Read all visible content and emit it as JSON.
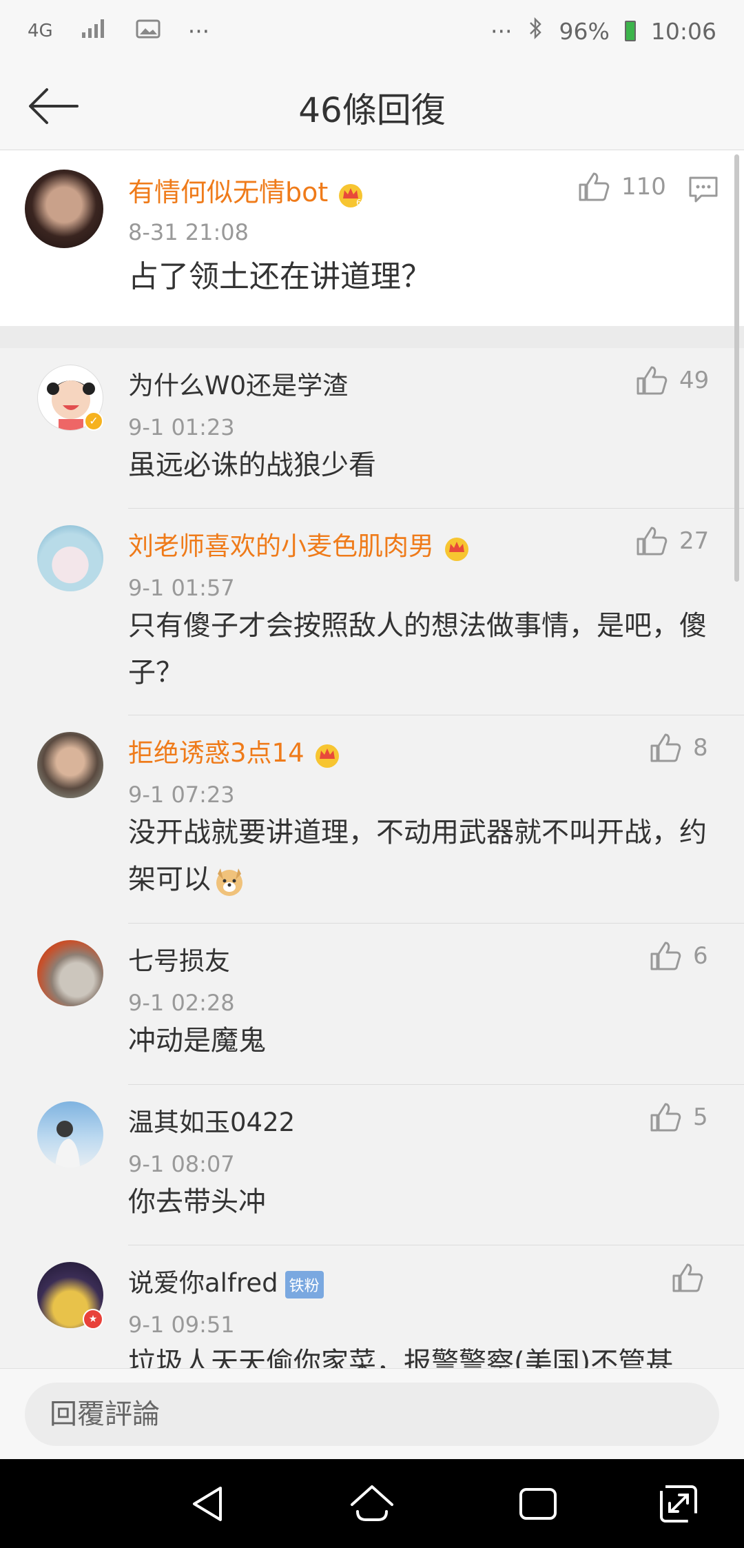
{
  "status": {
    "network": "4G",
    "battery": "96%",
    "time": "10:06",
    "dots": "···"
  },
  "header": {
    "title": "46條回復"
  },
  "top_comment": {
    "username": "有情何似无情bot",
    "time": "8-31 21:08",
    "likes": "110",
    "content": "占了领土还在讲道理？"
  },
  "replies": [
    {
      "username": "为什么W0还是学渣",
      "time": "9-1 01:23",
      "likes": "49",
      "content": "虽远必诛的战狼少看"
    },
    {
      "username": "刘老师喜欢的小麦色肌肉男",
      "time": "9-1 01:57",
      "likes": "27",
      "content": "只有傻子才会按照敌人的想法做事情，是吧，傻子？"
    },
    {
      "username": "拒绝诱惑3点14",
      "time": "9-1 07:23",
      "likes": "8",
      "content": "没开战就要讲道理，不动用武器就不叫开战，约架可以"
    },
    {
      "username": "七号损友",
      "time": "9-1 02:28",
      "likes": "6",
      "content": "冲动是魔鬼"
    },
    {
      "username": "温其如玉0422",
      "time": "9-1 08:07",
      "likes": "5",
      "content": "你去带头冲"
    },
    {
      "username": "说爱你alfred",
      "badge": "铁粉",
      "time": "9-1 09:51",
      "likes": "",
      "content": "垃圾人天天偷你家菜，报警警察(美国)不管甚"
    }
  ],
  "input": {
    "placeholder": "回覆評論"
  },
  "colors": {
    "vip_name": "#ef7b1a",
    "meta": "#999999",
    "accent_badge": "#7aa8e0"
  }
}
